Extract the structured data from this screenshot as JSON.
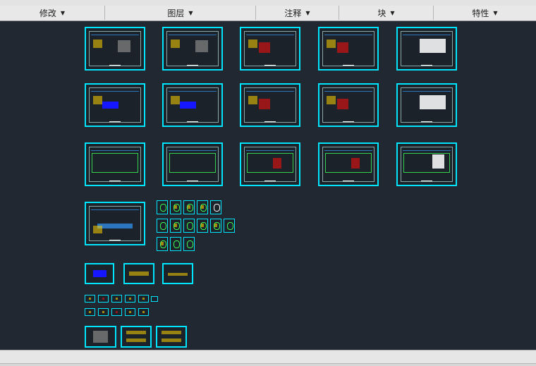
{
  "ribbon": {
    "groups": [
      {
        "label": "修改",
        "key": "modify"
      },
      {
        "label": "图层",
        "key": "layers"
      },
      {
        "label": "注释",
        "key": "annotation"
      },
      {
        "label": "块",
        "key": "block"
      },
      {
        "label": "特性",
        "key": "properties"
      }
    ]
  },
  "colors": {
    "canvas_bg": "#222831",
    "sheet_border": "#00e5ff",
    "ribbon_bg": "#e8e8e8"
  },
  "drawing": {
    "rows": [
      {
        "count": 5
      },
      {
        "count": 5
      },
      {
        "count": 5
      }
    ]
  }
}
